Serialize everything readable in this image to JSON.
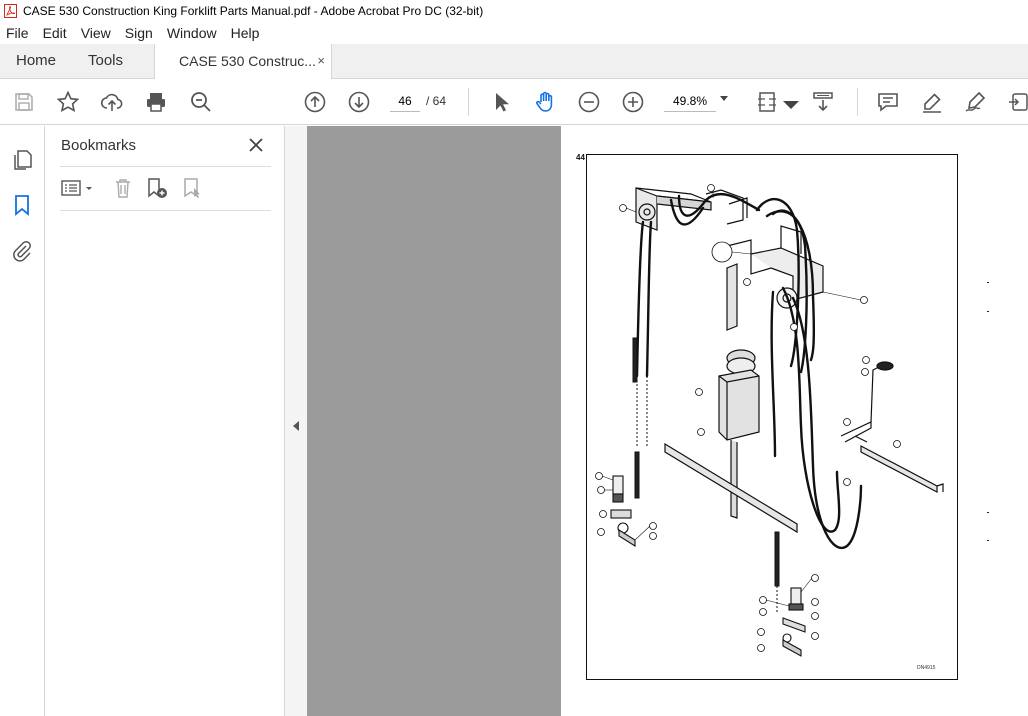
{
  "window": {
    "title": "CASE 530 Construction King Forklift Parts Manual.pdf - Adobe Acrobat Pro DC (32-bit)",
    "app_icon": "acrobat-icon",
    "accent_color": "#d7261e"
  },
  "menu": [
    "File",
    "Edit",
    "View",
    "Sign",
    "Window",
    "Help"
  ],
  "tabs": {
    "home": "Home",
    "tools": "Tools",
    "document": "CASE 530 Construc...",
    "close_glyph": "×"
  },
  "toolbar": {
    "current_page": "46",
    "page_total": "/ 64",
    "zoom": "49.8%",
    "icons": [
      "save-icon",
      "star-icon",
      "upload-icon",
      "print-icon",
      "search-zoom-icon",
      "page-up-icon",
      "page-down-icon",
      "select-cursor-icon",
      "hand-icon",
      "zoom-out-icon",
      "zoom-in-icon",
      "fit-page-icon",
      "scroll-mode-icon",
      "comment-icon",
      "highlight-icon",
      "sign-icon",
      "more-tools-icon"
    ]
  },
  "sidebar": {
    "icons": [
      "pages-icon",
      "bookmark-icon",
      "attachment-icon"
    ]
  },
  "bookmarks_panel": {
    "title": "Bookmarks",
    "icons": [
      "options-menu-icon",
      "delete-bookmark-icon",
      "new-bookmark-icon",
      "bookmark-from-selection-icon"
    ]
  },
  "document_page": {
    "page_number": "44",
    "figure_code": "DN4915"
  }
}
